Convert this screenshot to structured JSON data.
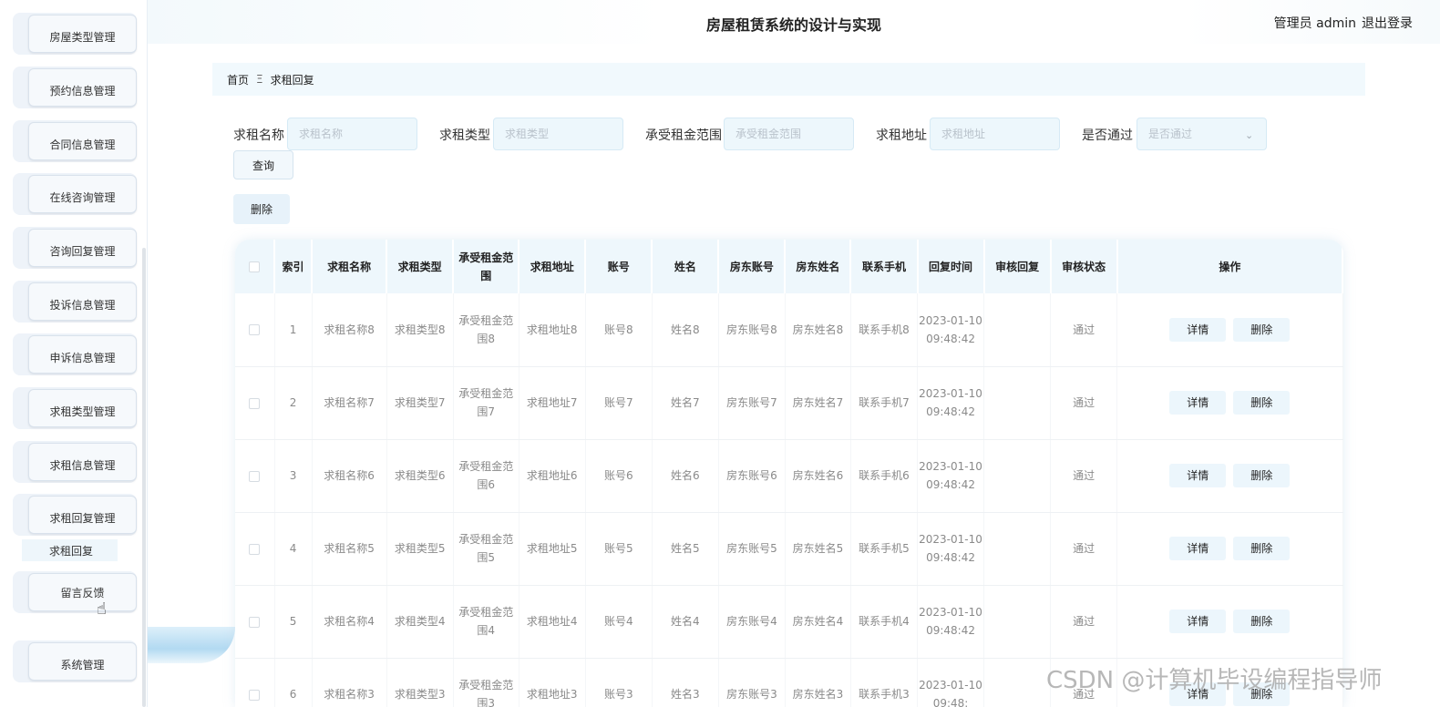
{
  "header": {
    "title": "房屋租赁系统的设计与实现",
    "user_label": "管理员 admin",
    "logout": "退出登录"
  },
  "sidebar": {
    "items": [
      {
        "label": "房屋类型管理"
      },
      {
        "label": "预约信息管理"
      },
      {
        "label": "合同信息管理"
      },
      {
        "label": "在线咨询管理"
      },
      {
        "label": "咨询回复管理"
      },
      {
        "label": "投诉信息管理"
      },
      {
        "label": "申诉信息管理"
      },
      {
        "label": "求租类型管理"
      },
      {
        "label": "求租信息管理"
      },
      {
        "label": "求租回复管理"
      },
      {
        "label": "留言反馈"
      },
      {
        "label": "系统管理"
      }
    ],
    "sub_item": "求租回复"
  },
  "breadcrumb": {
    "home": "首页",
    "separator": "Ξ",
    "current": "求租回复"
  },
  "search": {
    "name_label": "求租名称",
    "name_placeholder": "求租名称",
    "type_label": "求租类型",
    "type_placeholder": "求租类型",
    "rent_label": "承受租金范围",
    "rent_placeholder": "承受租金范围",
    "addr_label": "求租地址",
    "addr_placeholder": "求租地址",
    "pass_label": "是否通过",
    "pass_placeholder": "是否通过",
    "query_button": "查询"
  },
  "toolbar": {
    "delete_button": "删除"
  },
  "table": {
    "headers": {
      "index": "索引",
      "name": "求租名称",
      "type": "求租类型",
      "rent": "承受租金范围",
      "addr": "求租地址",
      "account": "账号",
      "person": "姓名",
      "landlord_account": "房东账号",
      "landlord_name": "房东姓名",
      "phone": "联系手机",
      "reply_time": "回复时间",
      "audit_reply": "审核回复",
      "audit_status": "审核状态",
      "actions": "操作"
    },
    "rows": [
      {
        "index": "1",
        "name": "求租名称8",
        "type": "求租类型8",
        "rent": "承受租金范围8",
        "addr": "求租地址8",
        "account": "账号8",
        "person": "姓名8",
        "landlord_account": "房东账号8",
        "landlord_name": "房东姓名8",
        "phone": "联系手机8",
        "reply_time": "2023-01-10 09:48:42",
        "audit_reply": "",
        "audit_status": "通过",
        "detail": "详情",
        "delete": "删除"
      },
      {
        "index": "2",
        "name": "求租名称7",
        "type": "求租类型7",
        "rent": "承受租金范围7",
        "addr": "求租地址7",
        "account": "账号7",
        "person": "姓名7",
        "landlord_account": "房东账号7",
        "landlord_name": "房东姓名7",
        "phone": "联系手机7",
        "reply_time": "2023-01-10 09:48:42",
        "audit_reply": "",
        "audit_status": "通过",
        "detail": "详情",
        "delete": "删除"
      },
      {
        "index": "3",
        "name": "求租名称6",
        "type": "求租类型6",
        "rent": "承受租金范围6",
        "addr": "求租地址6",
        "account": "账号6",
        "person": "姓名6",
        "landlord_account": "房东账号6",
        "landlord_name": "房东姓名6",
        "phone": "联系手机6",
        "reply_time": "2023-01-10 09:48:42",
        "audit_reply": "",
        "audit_status": "通过",
        "detail": "详情",
        "delete": "删除"
      },
      {
        "index": "4",
        "name": "求租名称5",
        "type": "求租类型5",
        "rent": "承受租金范围5",
        "addr": "求租地址5",
        "account": "账号5",
        "person": "姓名5",
        "landlord_account": "房东账号5",
        "landlord_name": "房东姓名5",
        "phone": "联系手机5",
        "reply_time": "2023-01-10 09:48:42",
        "audit_reply": "",
        "audit_status": "通过",
        "detail": "详情",
        "delete": "删除"
      },
      {
        "index": "5",
        "name": "求租名称4",
        "type": "求租类型4",
        "rent": "承受租金范围4",
        "addr": "求租地址4",
        "account": "账号4",
        "person": "姓名4",
        "landlord_account": "房东账号4",
        "landlord_name": "房东姓名4",
        "phone": "联系手机4",
        "reply_time": "2023-01-10 09:48:42",
        "audit_reply": "",
        "audit_status": "通过",
        "detail": "详情",
        "delete": "删除"
      },
      {
        "index": "6",
        "name": "求租名称3",
        "type": "求租类型3",
        "rent": "承受租金范围3",
        "addr": "求租地址3",
        "account": "账号3",
        "person": "姓名3",
        "landlord_account": "房东账号3",
        "landlord_name": "房东姓名3",
        "phone": "联系手机3",
        "reply_time": "2023-01-10 09:48:",
        "audit_reply": "",
        "audit_status": "通过",
        "detail": "详情",
        "delete": "删除"
      }
    ]
  },
  "watermark": "CSDN @计算机毕设编程指导师",
  "icons": {
    "select_chevron": "chevron-down-icon",
    "cursor": "hand-pointer-icon"
  }
}
